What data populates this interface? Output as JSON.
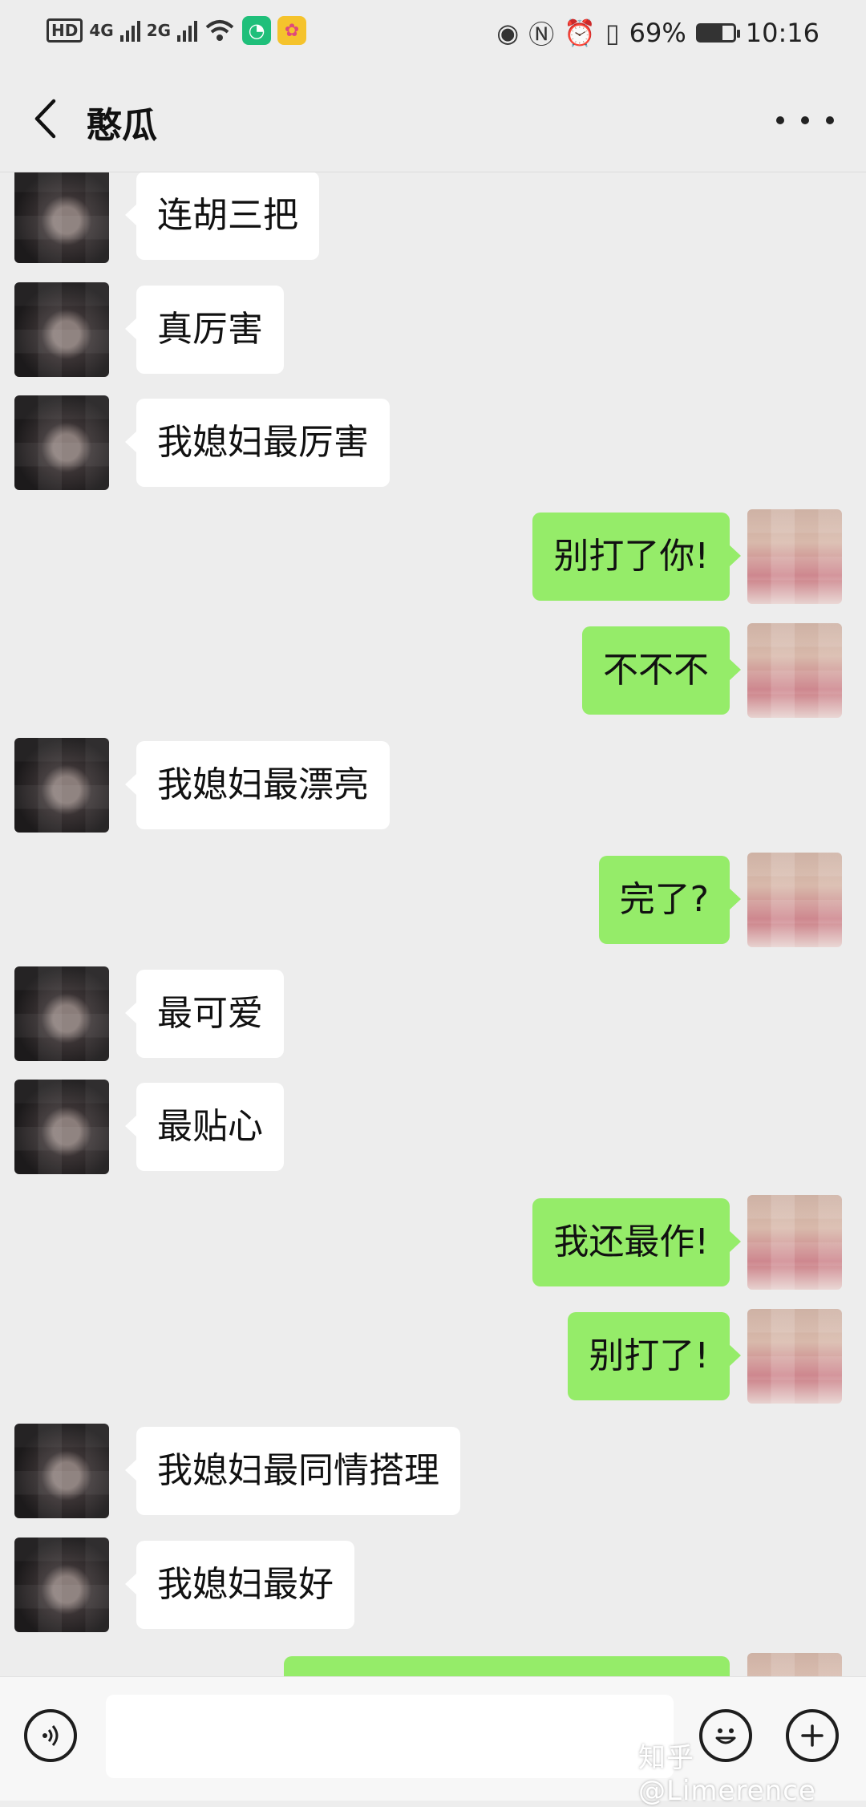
{
  "status_bar": {
    "hd_badge": "HD",
    "net_4g": "4G",
    "net_2g": "2G",
    "battery_percent": "69%",
    "battery_level": 0.69,
    "time": "10:16",
    "icons": [
      "hd-icon",
      "signal-4g-icon",
      "signal-2g-icon",
      "wifi-icon",
      "app-notification-icon",
      "app-notification-icon",
      "eye-icon",
      "nfc-icon",
      "alarm-icon",
      "vibrate-icon",
      "battery-icon"
    ]
  },
  "header": {
    "title": "憨瓜",
    "back_icon": "chevron-left-icon",
    "more_icon": "more-dots-icon"
  },
  "messages": [
    {
      "side": "left",
      "text": "连胡三把"
    },
    {
      "side": "left",
      "text": "真厉害"
    },
    {
      "side": "left",
      "text": "我媳妇最厉害"
    },
    {
      "side": "right",
      "text": "别打了你!"
    },
    {
      "side": "right",
      "text": "不不不"
    },
    {
      "side": "left",
      "text": "我媳妇最漂亮"
    },
    {
      "side": "right",
      "text": "完了?"
    },
    {
      "side": "left",
      "text": "最可爱"
    },
    {
      "side": "left",
      "text": "最贴心"
    },
    {
      "side": "right",
      "text": "我还最作!"
    },
    {
      "side": "right",
      "text": "别打了!"
    },
    {
      "side": "left",
      "text": "我媳妇最同情搭理"
    },
    {
      "side": "left",
      "text": "我媳妇最好"
    }
  ],
  "input_bar": {
    "voice_icon": "voice-icon",
    "emoji_icon": "emoji-icon",
    "plus_icon": "plus-icon",
    "input_value": ""
  },
  "watermark": "知乎 @Limerence",
  "colors": {
    "background": "#ededed",
    "bubble_self": "#95ec69",
    "bubble_other": "#ffffff"
  }
}
